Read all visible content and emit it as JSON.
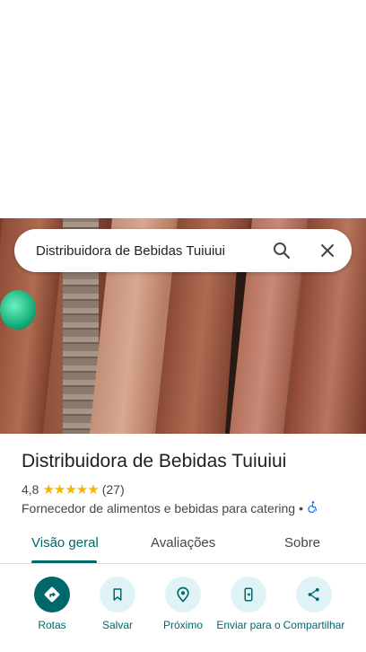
{
  "search": {
    "query": "Distribuidora de Bebidas Tuiuiui"
  },
  "place": {
    "name": "Distribuidora de Bebidas Tuiuiui",
    "rating": "4,8",
    "stars": "★★★★★",
    "review_count": "(27)",
    "category": "Fornecedor de alimentos e bebidas para catering",
    "separator": "•"
  },
  "tabs": [
    {
      "label": "Visão geral",
      "active": true
    },
    {
      "label": "Avaliações",
      "active": false
    },
    {
      "label": "Sobre",
      "active": false
    }
  ],
  "actions": [
    {
      "label": "Rotas",
      "icon": "directions-icon"
    },
    {
      "label": "Salvar",
      "icon": "bookmark-icon"
    },
    {
      "label": "Próximo",
      "icon": "nearby-icon"
    },
    {
      "label": "Enviar para o",
      "icon": "send-to-phone-icon"
    },
    {
      "label": "Compartilhar",
      "icon": "share-icon"
    }
  ],
  "colors": {
    "accent": "#00676b",
    "action_bg": "#dff3f6",
    "star": "#f4b400"
  }
}
